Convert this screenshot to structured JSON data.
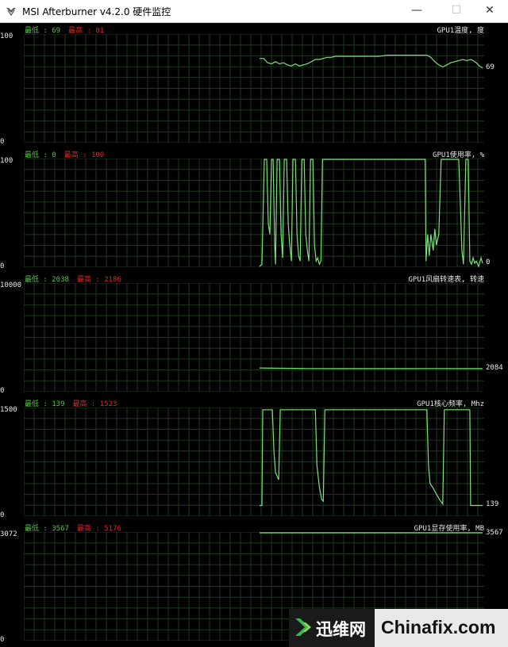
{
  "window": {
    "title": "MSI Afterburner v4.2.0 硬件监控",
    "minimize": "—",
    "maximize": "☐",
    "close": "✕",
    "logo_icon": "msi-dragon-icon"
  },
  "colors": {
    "background": "#000000",
    "grid": "#1e3a1e",
    "line": "#7fe07a",
    "min_text": "#59c34d",
    "max_text": "#d62a2a"
  },
  "panels": [
    {
      "title": "GPU1温度, 度",
      "min_text": "最低 : 69",
      "max_text": "最高 : 81",
      "y_top": "100",
      "y_bottom": "0",
      "current": "69",
      "ymax": 100,
      "points": [
        [
          0,
          78
        ],
        [
          5,
          78
        ],
        [
          10,
          74
        ],
        [
          15,
          73
        ],
        [
          20,
          75
        ],
        [
          25,
          73
        ],
        [
          30,
          74
        ],
        [
          35,
          72
        ],
        [
          40,
          71
        ],
        [
          45,
          73
        ],
        [
          50,
          71
        ],
        [
          55,
          72
        ],
        [
          60,
          73
        ],
        [
          65,
          75
        ],
        [
          70,
          77
        ],
        [
          75,
          77
        ],
        [
          80,
          78
        ],
        [
          85,
          79
        ],
        [
          90,
          79
        ],
        [
          95,
          80
        ],
        [
          100,
          80
        ],
        [
          110,
          80
        ],
        [
          120,
          80
        ],
        [
          130,
          80
        ],
        [
          140,
          80
        ],
        [
          150,
          80
        ],
        [
          160,
          81
        ],
        [
          170,
          81
        ],
        [
          180,
          81
        ],
        [
          190,
          81
        ],
        [
          200,
          81
        ],
        [
          205,
          81
        ],
        [
          210,
          81
        ],
        [
          215,
          79
        ],
        [
          220,
          75
        ],
        [
          225,
          72
        ],
        [
          230,
          70
        ],
        [
          235,
          72
        ],
        [
          240,
          74
        ],
        [
          245,
          75
        ],
        [
          250,
          76
        ],
        [
          255,
          77
        ],
        [
          260,
          76
        ],
        [
          265,
          77
        ],
        [
          268,
          76
        ],
        [
          272,
          74
        ],
        [
          276,
          71
        ],
        [
          280,
          69
        ]
      ]
    },
    {
      "title": "GPU1使用率, %",
      "min_text": "最低 : 0",
      "max_text": "最高 : 100",
      "y_top": "100",
      "y_bottom": "0",
      "current": "0",
      "ymax": 100,
      "points": [
        [
          0,
          0
        ],
        [
          3,
          2
        ],
        [
          6,
          100
        ],
        [
          9,
          100
        ],
        [
          11,
          40
        ],
        [
          13,
          30
        ],
        [
          15,
          100
        ],
        [
          17,
          100
        ],
        [
          19,
          20
        ],
        [
          20,
          2
        ],
        [
          22,
          100
        ],
        [
          25,
          100
        ],
        [
          27,
          30
        ],
        [
          29,
          8
        ],
        [
          31,
          100
        ],
        [
          34,
          100
        ],
        [
          36,
          40
        ],
        [
          38,
          20
        ],
        [
          40,
          5
        ],
        [
          42,
          100
        ],
        [
          45,
          100
        ],
        [
          47,
          30
        ],
        [
          49,
          10
        ],
        [
          51,
          5
        ],
        [
          53,
          100
        ],
        [
          56,
          100
        ],
        [
          58,
          30
        ],
        [
          60,
          15
        ],
        [
          62,
          5
        ],
        [
          64,
          100
        ],
        [
          67,
          100
        ],
        [
          69,
          20
        ],
        [
          71,
          5
        ],
        [
          73,
          8
        ],
        [
          75,
          2
        ],
        [
          77,
          5
        ],
        [
          79,
          100
        ],
        [
          85,
          100
        ],
        [
          100,
          100
        ],
        [
          120,
          100
        ],
        [
          140,
          100
        ],
        [
          160,
          100
        ],
        [
          180,
          100
        ],
        [
          200,
          100
        ],
        [
          205,
          100
        ],
        [
          208,
          100
        ],
        [
          209,
          5
        ],
        [
          211,
          30
        ],
        [
          213,
          10
        ],
        [
          215,
          30
        ],
        [
          218,
          15
        ],
        [
          220,
          35
        ],
        [
          222,
          20
        ],
        [
          225,
          30
        ],
        [
          228,
          100
        ],
        [
          235,
          100
        ],
        [
          245,
          100
        ],
        [
          250,
          100
        ],
        [
          252,
          60
        ],
        [
          254,
          15
        ],
        [
          256,
          2
        ],
        [
          259,
          100
        ],
        [
          262,
          100
        ],
        [
          264,
          5
        ],
        [
          266,
          2
        ],
        [
          268,
          8
        ],
        [
          270,
          3
        ],
        [
          272,
          5
        ],
        [
          275,
          0
        ],
        [
          278,
          8
        ],
        [
          280,
          3
        ]
      ]
    },
    {
      "title": "GPU1风扇转速表, 转速",
      "min_text": "最低 : 2038",
      "max_text": "最高 : 2186",
      "y_top": "10000",
      "y_bottom": "0",
      "current": "2084",
      "ymax": 10000,
      "points": [
        [
          0,
          2140
        ],
        [
          20,
          2120
        ],
        [
          60,
          2090
        ],
        [
          100,
          2080
        ],
        [
          140,
          2085
        ],
        [
          180,
          2080
        ],
        [
          220,
          2090
        ],
        [
          260,
          2085
        ],
        [
          280,
          2084
        ]
      ]
    },
    {
      "title": "GPU1核心频率, Mhz",
      "min_text": "最低 : 139",
      "max_text": "最高 : 1523",
      "y_top": "1500",
      "y_bottom": "0",
      "current": "139",
      "ymax": 1500,
      "points": [
        [
          0,
          139
        ],
        [
          3,
          139
        ],
        [
          4,
          1480
        ],
        [
          16,
          1480
        ],
        [
          18,
          900
        ],
        [
          20,
          600
        ],
        [
          22,
          550
        ],
        [
          24,
          500
        ],
        [
          26,
          1480
        ],
        [
          70,
          1480
        ],
        [
          72,
          700
        ],
        [
          75,
          400
        ],
        [
          78,
          220
        ],
        [
          80,
          200
        ],
        [
          82,
          1480
        ],
        [
          140,
          1480
        ],
        [
          205,
          1480
        ],
        [
          210,
          1480
        ],
        [
          212,
          700
        ],
        [
          214,
          450
        ],
        [
          218,
          380
        ],
        [
          222,
          300
        ],
        [
          226,
          220
        ],
        [
          230,
          160
        ],
        [
          232,
          1480
        ],
        [
          260,
          1480
        ],
        [
          264,
          1480
        ],
        [
          265,
          139
        ],
        [
          280,
          139
        ]
      ]
    },
    {
      "title": "GPU1显存使用率, MB",
      "min_text": "最低 : 3567",
      "max_text": "最高 : 5176",
      "y_top": "3072",
      "y_bottom": "0",
      "current": "3567",
      "ymax": 3072,
      "points": [
        [
          0,
          3567
        ],
        [
          280,
          3567
        ]
      ]
    }
  ],
  "watermark": {
    "cn_text": "迅维网",
    "en_text": "Chinafix.com",
    "icon": "xunwei-arrow-logo-icon"
  }
}
